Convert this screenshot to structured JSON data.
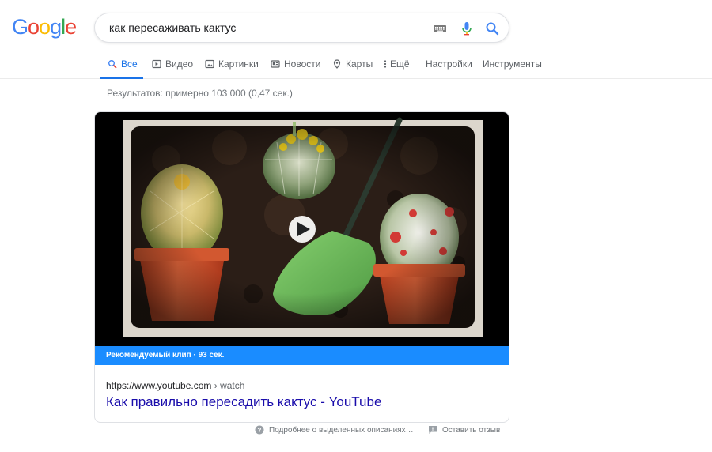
{
  "logo": {
    "letters": [
      "G",
      "o",
      "o",
      "g",
      "l",
      "e"
    ]
  },
  "search": {
    "query": "как пересаживать кактус",
    "icons": [
      "keyboard-icon",
      "microphone-icon",
      "search-icon"
    ]
  },
  "tabs": [
    {
      "label": "Все",
      "icon": "search-icon",
      "active": true
    },
    {
      "label": "Видео",
      "icon": "video-icon"
    },
    {
      "label": "Картинки",
      "icon": "image-icon"
    },
    {
      "label": "Новости",
      "icon": "news-icon"
    },
    {
      "label": "Карты",
      "icon": "map-pin-icon"
    },
    {
      "label": "Ещё",
      "icon": "more-vert-icon"
    },
    {
      "label": "Настройки"
    },
    {
      "label": "Инструменты"
    }
  ],
  "results_count": "Результатов: примерно 103 000 (0,47 сек.)",
  "featured": {
    "bar_label": "Рекомендуемый клип · 93 сек.",
    "url": "https://www.youtube.com",
    "url_crumb": "› watch",
    "title": "Как правильно пересадить кактус - YouTube"
  },
  "footer": {
    "about": "Подробнее о выделенных описаниях…",
    "feedback": "Оставить отзыв"
  },
  "colors": {
    "link_blue": "#1a0dab",
    "accent_blue": "#1a73e8",
    "featured_bar": "#1a8cff",
    "pot_orange": "#d9542b",
    "shovel_green": "#6cbf5a"
  }
}
